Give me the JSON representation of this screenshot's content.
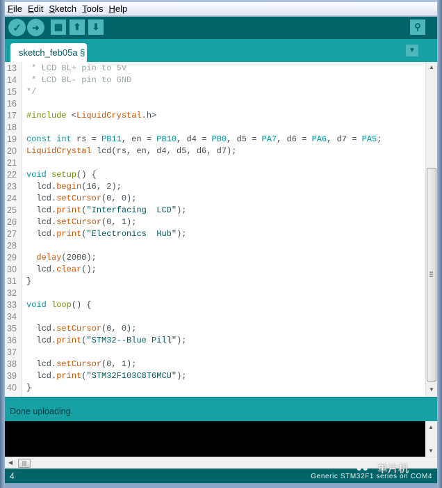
{
  "menu": {
    "items": [
      {
        "label": "File",
        "accel": "F",
        "rest": "ile"
      },
      {
        "label": "Edit",
        "accel": "E",
        "rest": "dit"
      },
      {
        "label": "Sketch",
        "accel": "S",
        "rest": "ketch"
      },
      {
        "label": "Tools",
        "accel": "T",
        "rest": "ools"
      },
      {
        "label": "Help",
        "accel": "H",
        "rest": "elp"
      }
    ]
  },
  "toolbar": {
    "verify_icon": "✓",
    "upload_icon": "➜",
    "new_icon": "▦",
    "open_icon": "⬆",
    "save_icon": "⬇",
    "serial_monitor_icon": "⚲"
  },
  "tabs": {
    "active": "sketch_feb05a §",
    "menu_icon": "▼"
  },
  "editor": {
    "lines": [
      {
        "n": "13",
        "html": "<span class=\"c-comment\"> * LCD BL+ pin to 5V</span>"
      },
      {
        "n": "14",
        "html": "<span class=\"c-comment\"> * LCD BL- pin to GND</span>"
      },
      {
        "n": "15",
        "html": "<span class=\"c-comment\">*/</span>"
      },
      {
        "n": "16",
        "html": ""
      },
      {
        "n": "17",
        "html": "<span class=\"c-type\">#include</span> &lt;<span class=\"c-cls\">LiquidCrystal</span>.h&gt;"
      },
      {
        "n": "18",
        "html": ""
      },
      {
        "n": "19",
        "html": "<span class=\"c-kw\">const</span> <span class=\"c-kw\">int</span> rs = <span class=\"c-const\">PB11</span>, en = <span class=\"c-const\">PB10</span>, d4 = <span class=\"c-const\">PB0</span>, d5 = <span class=\"c-const\">PA7</span>, d6 = <span class=\"c-const\">PA6</span>, d7 = <span class=\"c-const\">PA5</span>;"
      },
      {
        "n": "20",
        "html": "<span class=\"c-cls\">LiquidCrystal</span> lcd(rs, en, d4, d5, d6, d7);"
      },
      {
        "n": "21",
        "html": ""
      },
      {
        "n": "22",
        "html": "<span class=\"c-kw\">void</span> <span class=\"c-type\">setup</span>() {"
      },
      {
        "n": "23",
        "html": "  lcd.<span class=\"c-fn\">begin</span>(16, 2);"
      },
      {
        "n": "24",
        "html": "  lcd.<span class=\"c-fn\">setCursor</span>(0, 0);"
      },
      {
        "n": "25",
        "html": "  lcd.<span class=\"c-fn\">print</span>(<span class=\"c-str\">\"Interfacing  LCD\"</span>);"
      },
      {
        "n": "26",
        "html": "  lcd.<span class=\"c-fn\">setCursor</span>(0, 1);"
      },
      {
        "n": "27",
        "html": "  lcd.<span class=\"c-fn\">print</span>(<span class=\"c-str\">\"Electronics  Hub\"</span>);"
      },
      {
        "n": "28",
        "html": ""
      },
      {
        "n": "29",
        "html": "  <span class=\"c-fn\">delay</span>(2000);"
      },
      {
        "n": "30",
        "html": "  lcd.<span class=\"c-fn\">clear</span>();"
      },
      {
        "n": "31",
        "html": "}"
      },
      {
        "n": "32",
        "html": ""
      },
      {
        "n": "33",
        "html": "<span class=\"c-kw\">void</span> <span class=\"c-type\">loop</span>() {"
      },
      {
        "n": "34",
        "html": ""
      },
      {
        "n": "35",
        "html": "  lcd.<span class=\"c-fn\">setCursor</span>(0, 0);"
      },
      {
        "n": "36",
        "html": "  lcd.<span class=\"c-fn\">print</span>(<span class=\"c-str\">\"STM32--Blue Pill\"</span>);"
      },
      {
        "n": "37",
        "html": ""
      },
      {
        "n": "38",
        "html": "  lcd.<span class=\"c-fn\">setCursor</span>(0, 1);"
      },
      {
        "n": "39",
        "html": "  lcd.<span class=\"c-fn\">print</span>(<span class=\"c-str\">\"STM32F103C8T6MCU\"</span>);"
      },
      {
        "n": "40",
        "html": "}"
      }
    ]
  },
  "status": {
    "message": "Done uploading."
  },
  "footer": {
    "line_number": "4",
    "board": "Generic STM32F1 series on COM4"
  },
  "watermark": {
    "text": "单片机",
    "icon": "wechat-icon"
  },
  "colors": {
    "toolbar": "#006468",
    "tabbar": "#17a1a5",
    "button": "#4db7bb",
    "console": "#000000"
  }
}
